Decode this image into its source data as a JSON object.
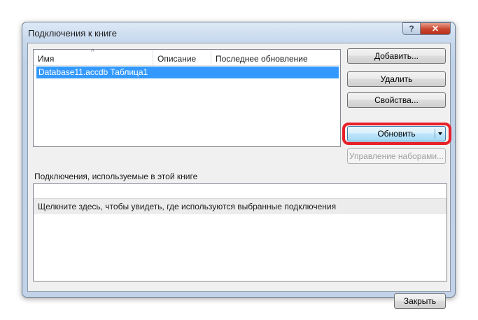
{
  "window": {
    "title": "Подключения к книге",
    "help_label": "?",
    "close_label": "✕"
  },
  "connections_list": {
    "columns": [
      "Имя",
      "Описание",
      "Последнее обновление"
    ],
    "sort_indicator": "^",
    "rows": [
      {
        "name": "Database11.accdb Таблица1",
        "description": "",
        "last_updated": ""
      }
    ]
  },
  "buttons": {
    "add": "Добавить...",
    "remove": "Удалить",
    "properties": "Свойства...",
    "refresh": "Обновить",
    "manage_sets": "Управление наборами..."
  },
  "usage_section": {
    "label": "Подключения, используемые в этой книге",
    "hint": "Щелкните здесь, чтобы увидеть, где используются выбранные подключения"
  },
  "footer": {
    "close": "Закрыть"
  },
  "colors": {
    "selection": "#3399ff",
    "highlight_ring": "#e8202a"
  }
}
